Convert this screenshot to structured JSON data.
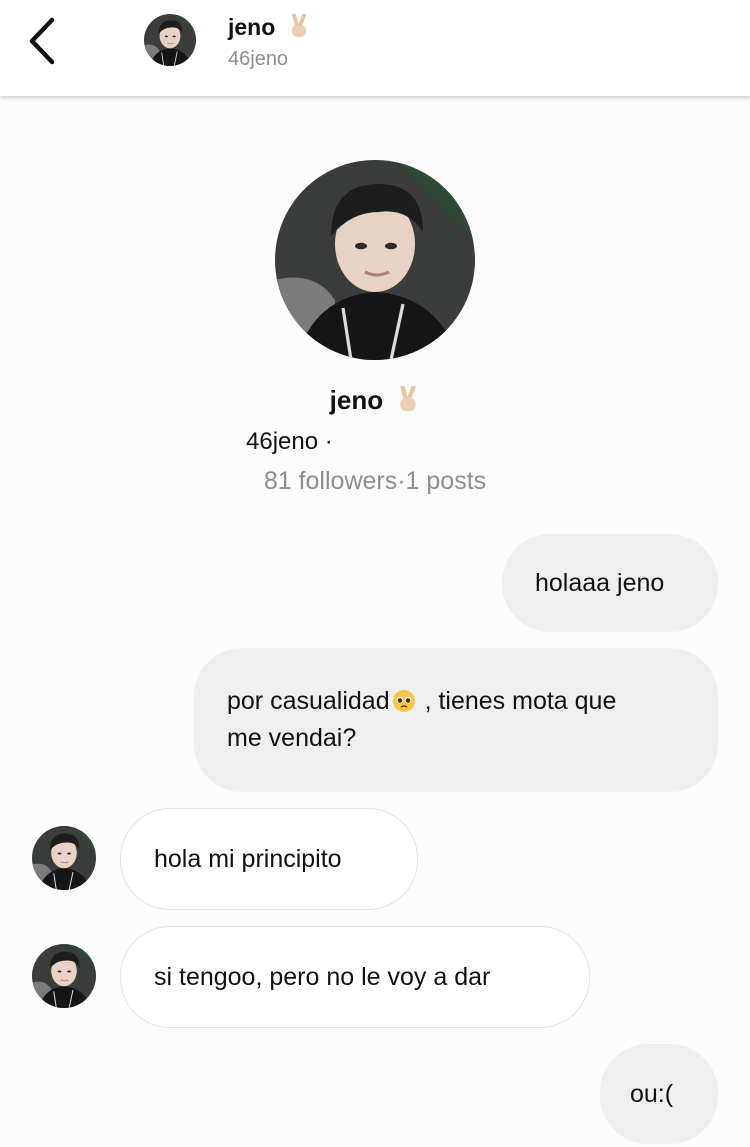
{
  "header": {
    "display_name": "jeno",
    "username": "46jeno"
  },
  "profile": {
    "display_name": "jeno",
    "username_line": "46jeno ·",
    "stats": "81 followers·1 posts"
  },
  "messages": [
    {
      "direction": "outgoing",
      "text": "holaaa jeno"
    },
    {
      "direction": "outgoing",
      "text_before": "por casualidad",
      "emoji": "pleading-face",
      "text_after": " , tienes mota que me vendai?"
    },
    {
      "direction": "incoming",
      "text": "hola mi principito"
    },
    {
      "direction": "incoming",
      "text": "si tengoo, pero no le voy a dar"
    },
    {
      "direction": "outgoing",
      "text": "ou:("
    }
  ],
  "icons": {
    "back": "chevron-left-icon",
    "name_emoji": "victory-hand-icon",
    "avatar": "profile-photo"
  },
  "colors": {
    "outgoing_bubble": "#efefef",
    "incoming_bubble": "#ffffff",
    "secondary_text": "#8e8e8e"
  }
}
